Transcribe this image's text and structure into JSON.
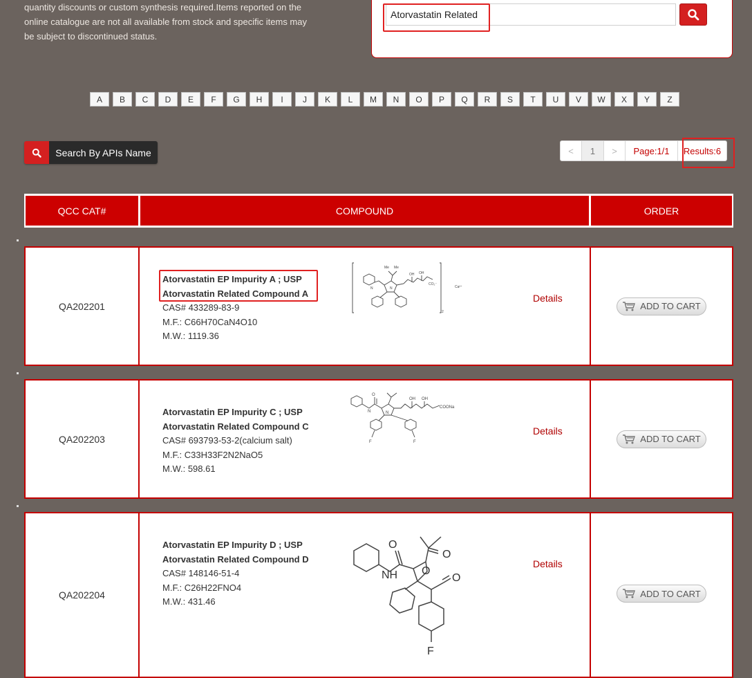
{
  "intro": {
    "lines": [
      "quantity discounts or custom synthesis required.Items reported on the",
      "online catalogue are not all available from stock and specific items may",
      "be subject to discontinued status."
    ]
  },
  "search": {
    "value": "Atorvastatin Related"
  },
  "alphabet": [
    "A",
    "B",
    "C",
    "D",
    "E",
    "F",
    "G",
    "H",
    "I",
    "J",
    "K",
    "L",
    "M",
    "N",
    "O",
    "P",
    "Q",
    "R",
    "S",
    "T",
    "U",
    "V",
    "W",
    "X",
    "Y",
    "Z"
  ],
  "api_search": {
    "label": "Search By APIs Name"
  },
  "pager": {
    "prev": "<",
    "page": "1",
    "next": ">",
    "page_info": "Page:1/1",
    "results": "Results:6"
  },
  "table": {
    "headers": {
      "cat": "QCC CAT#",
      "compound": "COMPOUND",
      "order": "ORDER"
    },
    "details_label": "Details",
    "cart_label": "ADD TO CART",
    "rows": [
      {
        "cat": "QA202201",
        "name1": "Atorvastatin EP Impurity A ; USP",
        "name2": "Atorvastatin Related Compound A",
        "cas": "CAS# 433289-83-9",
        "mf": "M.F.: C66H70CaN4O10",
        "mw": "M.W.: 1119.36"
      },
      {
        "cat": "QA202203",
        "name1": "Atorvastatin EP Impurity C ; USP",
        "name2": "Atorvastatin Related Compound C",
        "cas": "CAS# 693793-53-2(calcium salt)",
        "mf": "M.F.: C33H33F2N2NaO5",
        "mw": "M.W.: 598.61"
      },
      {
        "cat": "QA202204",
        "name1": "Atorvastatin EP Impurity D ; USP",
        "name2": "Atorvastatin Related Compound D",
        "cas": "CAS# 148146-51-4",
        "mf": "M.F.: C26H22FNO4",
        "mw": "M.W.: 431.46"
      }
    ]
  },
  "structure_labels": {
    "s1": {
      "me1": "Me",
      "me2": "Me",
      "oh1": "OH",
      "oh2": "OH",
      "nh": "N",
      "coo": "CO₂⁻",
      "n": "N",
      "ca": "Ca²⁺",
      "sub": "2"
    },
    "s2": {
      "oh1": "OH",
      "oh2": "OH",
      "nh": "N",
      "n": "N",
      "o": "O",
      "coona": "COONa",
      "f1": "F",
      "f2": "F"
    },
    "s3": {
      "o1": "O",
      "o2": "O",
      "o3": "O",
      "o4": "O",
      "nh": "NH",
      "f": "F"
    }
  },
  "colors": {
    "accent": "#cc0000",
    "background": "#6b635e"
  }
}
